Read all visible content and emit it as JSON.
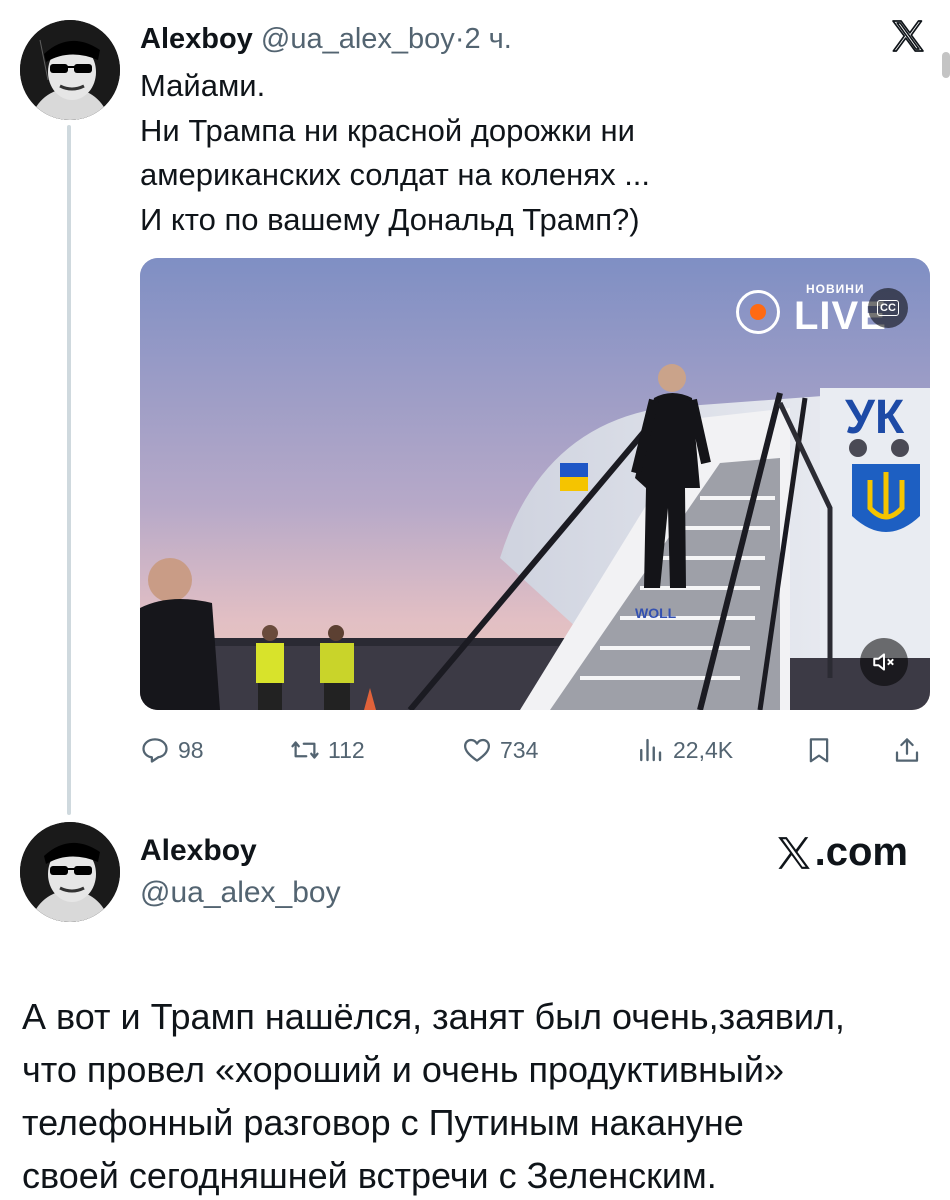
{
  "tweet": {
    "author_name": "Alexboy",
    "handle": "@ua_alex_boy",
    "separator": "·",
    "time": "2 ч.",
    "body_lines": [
      "Майами.",
      "Ни Трампа ни красной дорожки ни",
      "американских солдат на коленях ...",
      "И кто по вашему Дональд Трамп?)"
    ],
    "media": {
      "watermark_small": "НОВИНИ",
      "watermark_big": "LIVE",
      "cc_label": "CC",
      "aircraft_lettering": "УК",
      "stair_lettering": "WOLL"
    },
    "actions": {
      "replies": "98",
      "reposts": "112",
      "likes": "734",
      "views": "22,4K"
    }
  },
  "quoted_card": {
    "author_name": "Alexboy",
    "handle": "@ua_alex_boy",
    "brand": ".com",
    "body_lines": [
      "А вот и Трамп нашёлся, занят был очень,заявил,",
      "что провел «хороший и очень продуктивный»",
      "телефонный разговор с Путиным накануне",
      "своей сегодняшней встречи с Зеленским."
    ]
  },
  "colors": {
    "text_primary": "#0f1419",
    "text_secondary": "#536471",
    "thread_line": "#cfd9de",
    "live_accent": "#ff6a13"
  },
  "icons": [
    "x-logo-icon",
    "reply-icon",
    "retweet-icon",
    "like-icon",
    "views-icon",
    "bookmark-icon",
    "share-icon",
    "mute-icon",
    "cc-icon"
  ]
}
